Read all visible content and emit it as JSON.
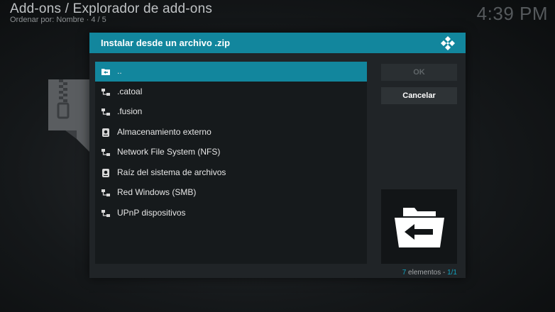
{
  "background": {
    "title": "Add-ons / Explorador de add-ons",
    "subtitle": "Ordenar por: Nombre  · 4 / 5",
    "clock": "4:39 PM"
  },
  "dialog": {
    "title": "Instalar desde un archivo .zip",
    "items": [
      {
        "label": "..",
        "icon": "folder-back-icon"
      },
      {
        "label": ".catoal",
        "icon": "network-icon"
      },
      {
        "label": ".fusion",
        "icon": "network-icon"
      },
      {
        "label": "Almacenamiento externo",
        "icon": "drive-icon"
      },
      {
        "label": "Network File System (NFS)",
        "icon": "network-icon"
      },
      {
        "label": "Raíz del sistema de archivos",
        "icon": "drive-icon"
      },
      {
        "label": "Red Windows (SMB)",
        "icon": "network-icon"
      },
      {
        "label": "UPnP dispositivos",
        "icon": "network-icon"
      }
    ],
    "buttons": {
      "ok": "OK",
      "cancel": "Cancelar"
    },
    "footer": {
      "count": "7",
      "count_label": " elementos - ",
      "page": "1/1"
    }
  },
  "colors": {
    "accent": "#12869d",
    "dialog_bg": "#202427",
    "list_bg": "#161a1c"
  }
}
